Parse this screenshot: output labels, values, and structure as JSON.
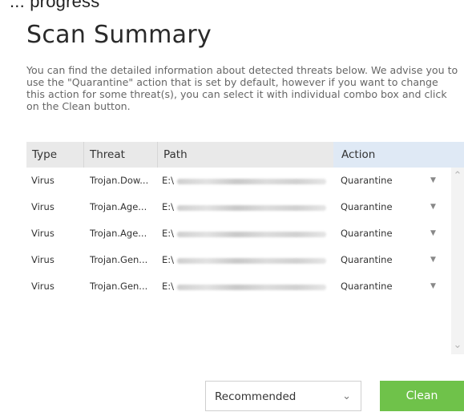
{
  "window": {
    "top_text": "... progress",
    "title": "Scan Summary",
    "description": "You can find the detailed information about detected threats below. We advise you to use the \"Quarantine\" action that is set by default, however if you want to change this action for some threat(s), you can select it with individual combo box and click on the Clean button."
  },
  "table": {
    "headers": {
      "type": "Type",
      "threat": "Threat",
      "path": "Path",
      "action": "Action"
    },
    "rows": [
      {
        "type": "Virus",
        "threat": "Trojan.Dow...",
        "path": "E:\\",
        "action": "Quarantine"
      },
      {
        "type": "Virus",
        "threat": "Trojan.Age...",
        "path": "E:\\",
        "action": "Quarantine"
      },
      {
        "type": "Virus",
        "threat": "Trojan.Age...",
        "path": "E:\\",
        "action": "Quarantine"
      },
      {
        "type": "Virus",
        "threat": "Trojan.Gen...",
        "path": "E:\\",
        "action": "Quarantine"
      },
      {
        "type": "Virus",
        "threat": "Trojan.Gen...",
        "path": "E:\\",
        "action": "Quarantine"
      }
    ]
  },
  "footer": {
    "mode_select_value": "Recommended",
    "clean_label": "Clean"
  },
  "icons": {
    "row_dropdown": "chevron-down-icon",
    "combo_dropdown": "chevron-down-icon",
    "scroll_up": "chevron-up-icon",
    "scroll_down": "chevron-down-icon"
  },
  "colors": {
    "accent_green": "#6fc24a",
    "action_header": "#dfe9f5",
    "table_header": "#e9e9e9"
  }
}
